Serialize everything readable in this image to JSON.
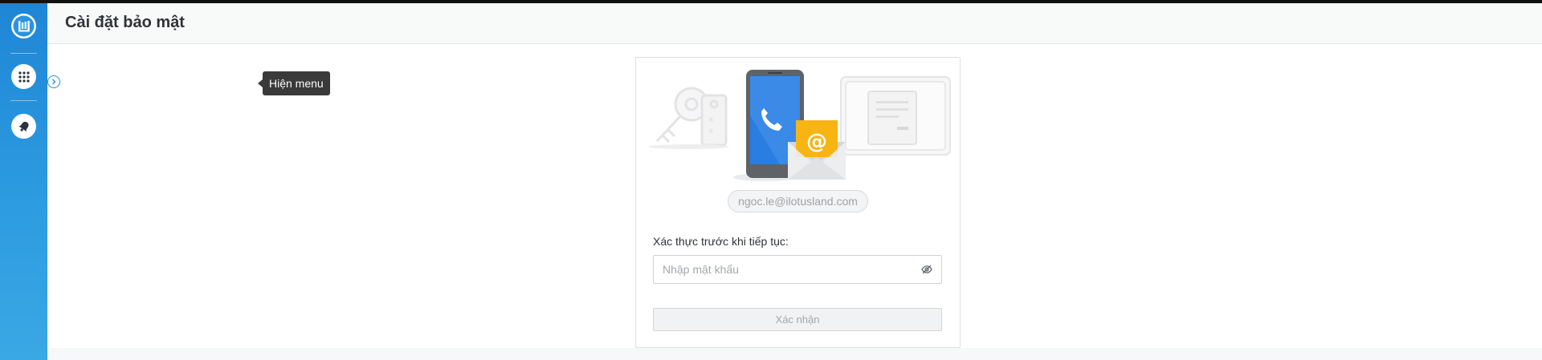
{
  "header": {
    "title": "Cài đặt bảo mật"
  },
  "sidebar": {
    "items": [
      {
        "icon": "app-logo-icon"
      },
      {
        "icon": "apps-grid-icon"
      },
      {
        "icon": "notification-bell-icon"
      }
    ],
    "expand_tooltip": "Hiện menu"
  },
  "security": {
    "account_email": "ngoc.le@ilotusland.com",
    "verify_prompt": "Xác thực trước khi tiếp tục:",
    "password_placeholder": "Nhập mật khẩu",
    "confirm_label": "Xác nhận"
  },
  "colors": {
    "rail_top": "#1f86d6",
    "rail_bottom": "#3aa8e4",
    "phone_blue": "#2a7de1",
    "envelope_yellow": "#f8b413"
  }
}
